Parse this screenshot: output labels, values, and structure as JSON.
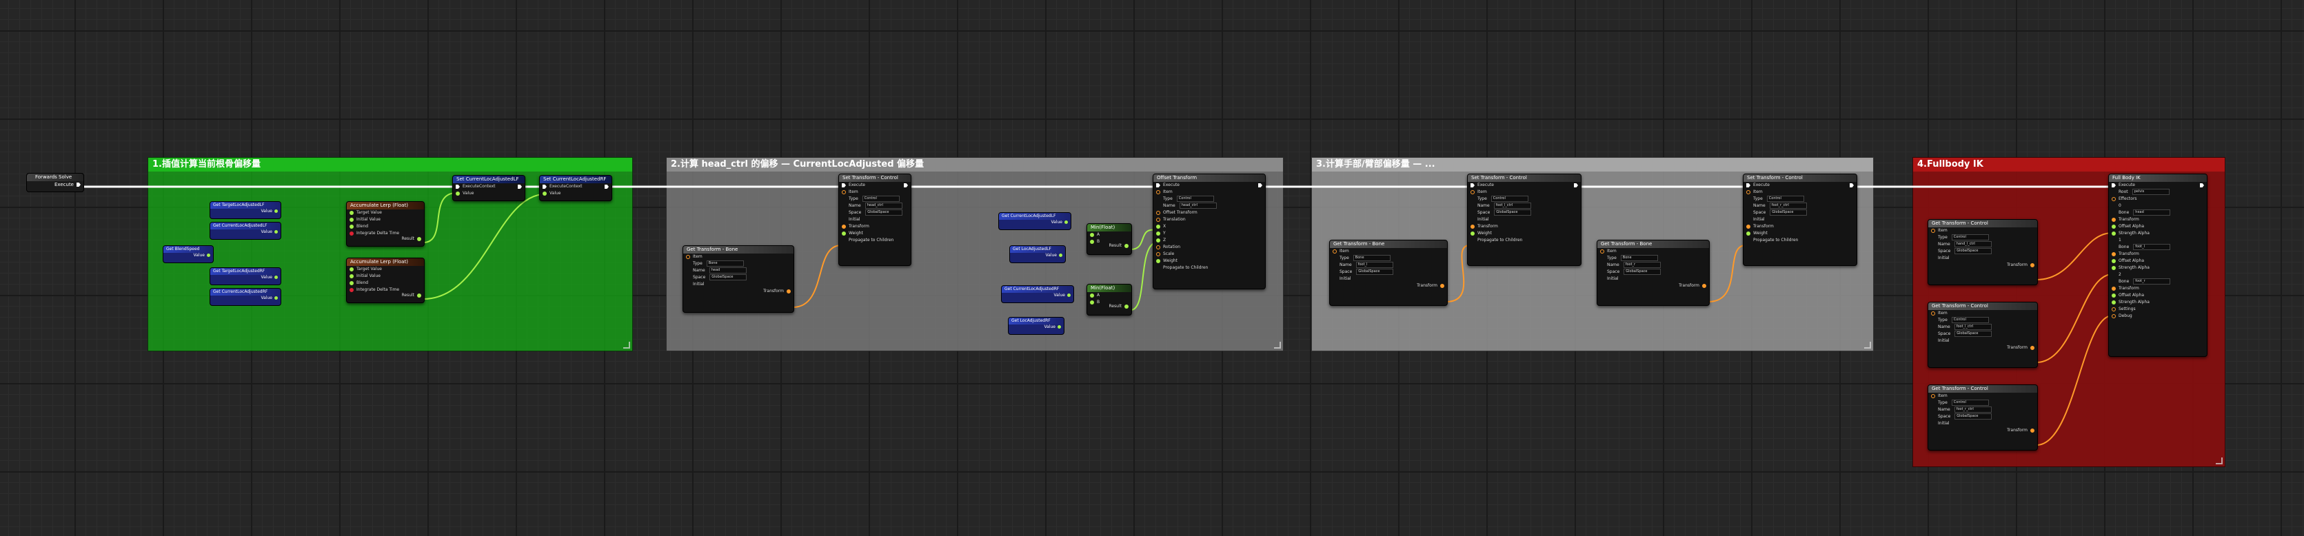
{
  "comments": {
    "c1": "1.插值计算当前根骨偏移量",
    "c2": "2.计算 head_ctrl 的偏移 — CurrentLocAdjusted 偏移量",
    "c3": "3.计算手部/臂部偏移量 — ...",
    "c4": "4.Fullbody IK"
  },
  "event": {
    "title": "Forwards Solve",
    "pin": "Execute"
  },
  "vars": {
    "blendspeed": "Get BlendSpeed",
    "target_lf": "Get TargetLocAdjustedLF",
    "current_lf": "Get CurrentLocAdjustedLF",
    "target_rf": "Get TargetLocAdjustedRF",
    "current_rf": "Get CurrentLocAdjustedRF",
    "value": "Value",
    "loclf": "Get LocAdjustedLF",
    "locrf": "Get LocAdjustedRF",
    "rootlf": "Get CurrentLocAdjustedLF",
    "rootrf": "Get CurrentLocAdjustedRF"
  },
  "accum": {
    "title": "Accumulate Lerp (Float)",
    "pins": [
      "Target Value",
      "Initial Value",
      "Blend",
      "Integrate Delta Time"
    ],
    "result": "Result"
  },
  "setters": {
    "set_lf": "Set CurrentLocAdjustedLF",
    "set_rf": "Set CurrentLocAdjustedRF",
    "execute": "Execute",
    "executecontext": "ExecuteContext",
    "value": "Value"
  },
  "minmax": {
    "title": "Min(Float)",
    "a": "A",
    "b": "B",
    "result": "Result"
  },
  "offset": {
    "title": "Offset Transform",
    "pins": [
      "Execute",
      "Item",
      "Type",
      "Name",
      "Offset Transform",
      "Translation",
      "X",
      "Y",
      "Z",
      "Rotation",
      "Scale",
      "Weight",
      "Propagate to Children"
    ],
    "type_val": "Control",
    "name_val": "head_ctrl"
  },
  "get_bone": {
    "title": "Get Transform - Bone",
    "item": "Item",
    "type": "Type",
    "type_val": "Bone",
    "name": "Name",
    "space": "Space",
    "space_val": "GlobalSpace",
    "initial": "Initial",
    "transform": "Transform",
    "names": [
      "head",
      "foot_l",
      "foot_r"
    ]
  },
  "set_ctrl": {
    "title": "Set Transform - Control",
    "pins": [
      "Execute",
      "Item",
      "Type",
      "Name",
      "Space",
      "Initial",
      "Transform",
      "Weight",
      "Propagate to Children"
    ],
    "type_val": "Control",
    "names": [
      "head_ctrl",
      "foot_l_ctrl",
      "foot_r_ctrl"
    ],
    "space_val": "GlobalSpace"
  },
  "get_ctrl": {
    "title": "Get Transform - Control",
    "names": [
      "hand_l_ctrl",
      "foot_l_ctrl",
      "foot_r_ctrl"
    ]
  },
  "fbik": {
    "title": "Full Body IK",
    "pins": [
      "Execute",
      "Root",
      "Effectors",
      "0",
      "Bone",
      "Transform",
      "Offset Alpha",
      "Strength Alpha",
      "1",
      "2",
      "Settings",
      "Debug"
    ],
    "root_val": "pelvis",
    "bones": [
      "head",
      "foot_l",
      "foot_r"
    ]
  },
  "colors": {
    "green": "#1d9a1d",
    "gray": "#6d6d6d",
    "lightgray": "#9a9a9a",
    "red": "#8f1111",
    "exec": "#ffffff",
    "float": "#a4f04a",
    "transform": "#ff9a2a"
  }
}
